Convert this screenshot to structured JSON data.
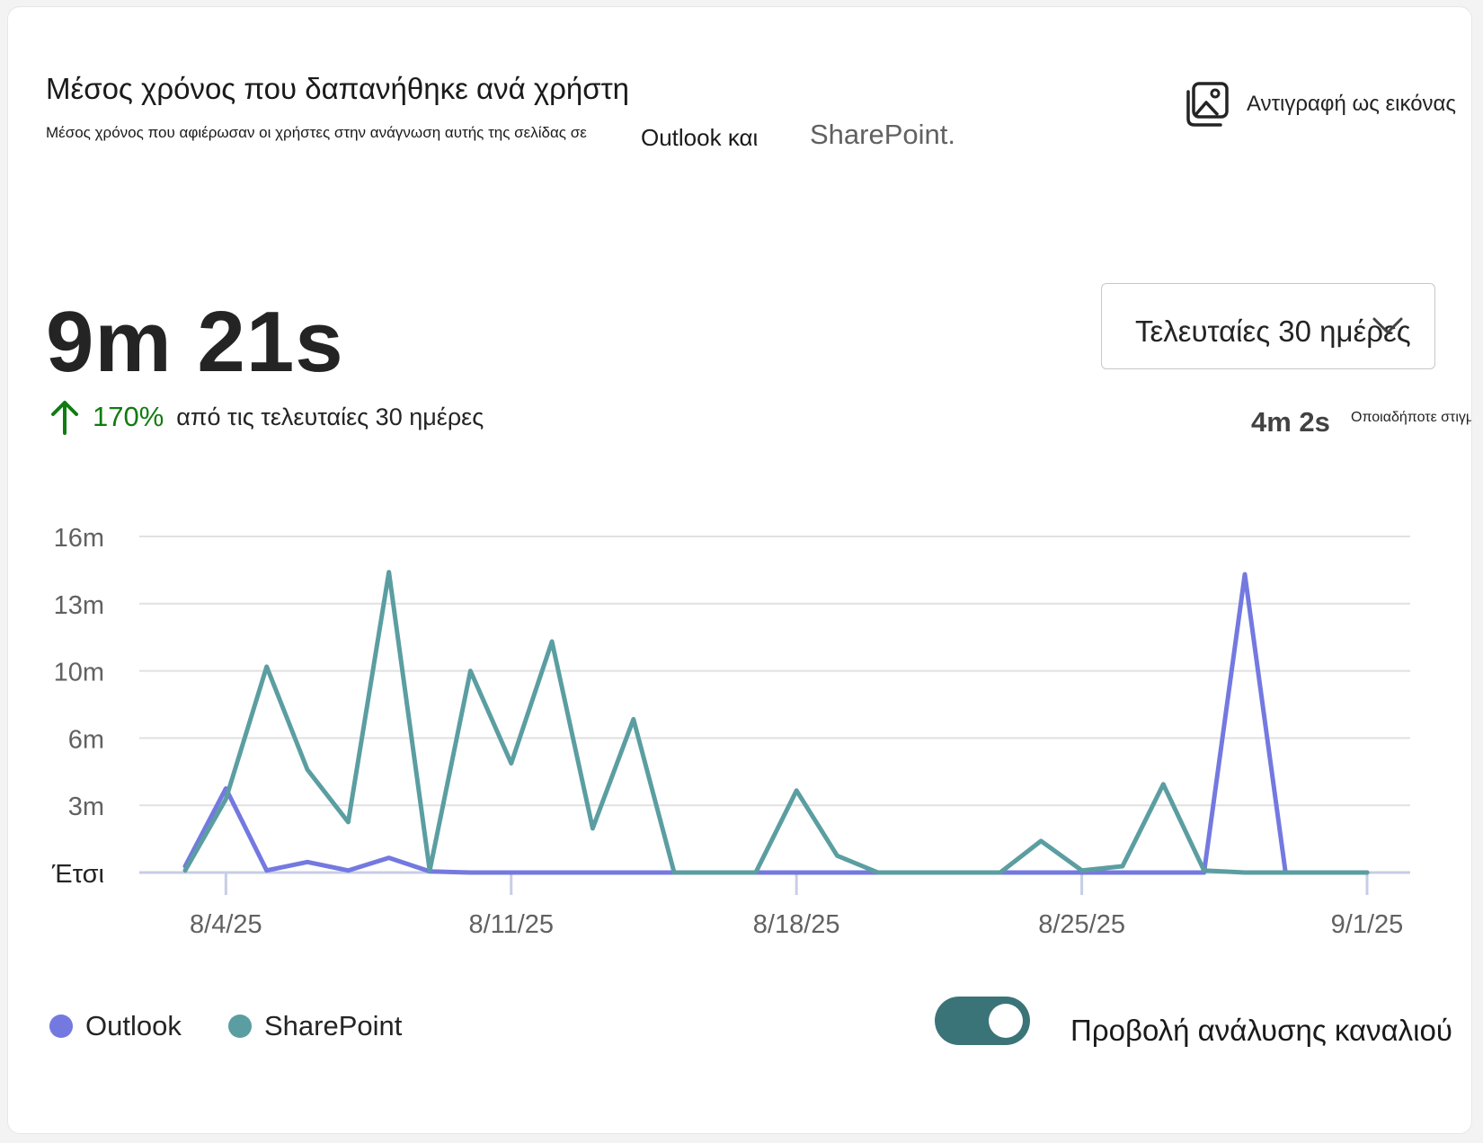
{
  "header": {
    "title": "Μέσος χρόνος που δαπανήθηκε ανά χρήστη",
    "subtitle": "Μέσος χρόνος που αφιέρωσαν οι χρήστες στην ανάγνωση αυτής της σελίδας σε",
    "subtitle_outlook": "Outlook και",
    "subtitle_sharepoint": "SharePoint.",
    "copy_label": "Αντιγραφή ως εικόνας"
  },
  "metric": {
    "value": "9m 21s",
    "change_pct": "170%",
    "change_desc": "από τις τελευταίες 30 ημέρες",
    "change_color": "#107c10",
    "previous_value": "4m 2s",
    "previous_label": "Οποιαδήποτε στιγμή"
  },
  "range_dropdown": {
    "selected": "Τελευταίες 30 ημέρες"
  },
  "toggle": {
    "label": "Προβολή ανάλυσης καναλιού",
    "on": true,
    "color": "#3b7478"
  },
  "chart_data": {
    "type": "line",
    "x": [
      "8/3/25",
      "8/4/25",
      "8/5/25",
      "8/6/25",
      "8/7/25",
      "8/8/25",
      "8/9/25",
      "8/10/25",
      "8/11/25",
      "8/12/25",
      "8/13/25",
      "8/14/25",
      "8/15/25",
      "8/16/25",
      "8/17/25",
      "8/18/25",
      "8/19/25",
      "8/20/25",
      "8/21/25",
      "8/22/25",
      "8/23/25",
      "8/24/25",
      "8/25/25",
      "8/26/25",
      "8/27/25",
      "8/28/25",
      "8/29/25",
      "8/30/25",
      "8/31/25",
      "9/1/25"
    ],
    "x_tick_labels": [
      "8/4/25",
      "8/11/25",
      "8/18/25",
      "8/25/25",
      "9/1/25"
    ],
    "y_tick_labels": [
      "Έτσι",
      "3m",
      "6m",
      "10m",
      "13m",
      "16m"
    ],
    "y_tick_values": [
      0,
      3.2,
      6.4,
      9.6,
      12.8,
      16
    ],
    "ylim": [
      0,
      16
    ],
    "grid": true,
    "legend_position": "bottom-left",
    "series": [
      {
        "name": "Outlook",
        "color": "#7479e0",
        "values": [
          0.3,
          4.0,
          0.1,
          0.5,
          0.1,
          0.7,
          0.05,
          0,
          0,
          0,
          0,
          0,
          0,
          0,
          0,
          0,
          0,
          0,
          0,
          0,
          0,
          0,
          0,
          0,
          0,
          0,
          14.2,
          0,
          0,
          0
        ]
      },
      {
        "name": "SharePoint",
        "color": "#5b9ea1",
        "values": [
          0.1,
          3.5,
          9.8,
          4.9,
          2.4,
          14.3,
          0.1,
          9.6,
          5.2,
          11.0,
          2.1,
          7.3,
          0,
          0,
          0,
          3.9,
          0.8,
          0,
          0,
          0,
          0,
          1.5,
          0.1,
          0.3,
          4.2,
          0.1,
          0,
          0,
          0,
          0
        ]
      }
    ]
  }
}
